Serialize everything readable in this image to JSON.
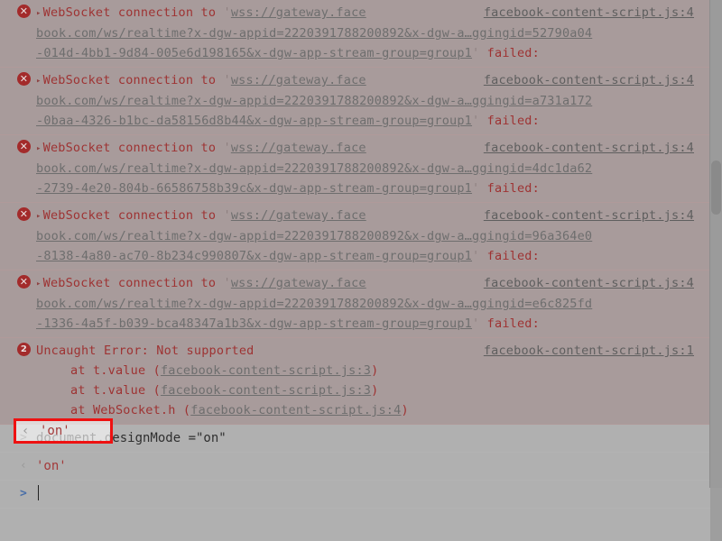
{
  "console": {
    "messages": [
      {
        "kind": "error",
        "icon": "error-circle-icon",
        "disclosure": "▸",
        "prefix": "WebSocket connection to ",
        "open_quote": "'",
        "url_part1": "wss://gateway.face",
        "url_part2": "book.com/ws/realtime?x-dgw-appid=2220391788200892&x-dgw-a…ggingid=52790a04",
        "url_part3": "-014d-4bb1-9d84-005e6d198165&x-dgw-app-stream-group=group1",
        "close_quote": "'",
        "suffix": "failed:",
        "source": "facebook-content-script.js:4"
      },
      {
        "kind": "error",
        "icon": "error-circle-icon",
        "disclosure": "▸",
        "prefix": "WebSocket connection to ",
        "open_quote": "'",
        "url_part1": "wss://gateway.face",
        "url_part2": "book.com/ws/realtime?x-dgw-appid=2220391788200892&x-dgw-a…ggingid=a731a172",
        "url_part3": "-0baa-4326-b1bc-da58156d8b44&x-dgw-app-stream-group=group1",
        "close_quote": "'",
        "suffix": "failed:",
        "source": "facebook-content-script.js:4"
      },
      {
        "kind": "error",
        "icon": "error-circle-icon",
        "disclosure": "▸",
        "prefix": "WebSocket connection to ",
        "open_quote": "'",
        "url_part1": "wss://gateway.face",
        "url_part2": "book.com/ws/realtime?x-dgw-appid=2220391788200892&x-dgw-a…ggingid=4dc1da62",
        "url_part3": "-2739-4e20-804b-66586758b39c&x-dgw-app-stream-group=group1",
        "close_quote": "'",
        "suffix": "failed:",
        "source": "facebook-content-script.js:4"
      },
      {
        "kind": "error",
        "icon": "error-circle-icon",
        "disclosure": "▸",
        "prefix": "WebSocket connection to ",
        "open_quote": "'",
        "url_part1": "wss://gateway.face",
        "url_part2": "book.com/ws/realtime?x-dgw-appid=2220391788200892&x-dgw-a…ggingid=96a364e0",
        "url_part3": "-8138-4a80-ac70-8b234c990807&x-dgw-app-stream-group=group1",
        "close_quote": "'",
        "suffix": "failed:",
        "source": "facebook-content-script.js:4"
      },
      {
        "kind": "error",
        "icon": "error-circle-icon",
        "disclosure": "▸",
        "prefix": "WebSocket connection to ",
        "open_quote": "'",
        "url_part1": "wss://gateway.face",
        "url_part2": "book.com/ws/realtime?x-dgw-appid=2220391788200892&x-dgw-a…ggingid=e6c825fd",
        "url_part3": "-1336-4a5f-b039-bca48347a1b3&x-dgw-app-stream-group=group1",
        "close_quote": "'",
        "suffix": "failed:",
        "source": "facebook-content-script.js:4"
      }
    ],
    "uncaught": {
      "badge_count": "2",
      "title": "Uncaught Error: Not supported",
      "source": "facebook-content-script.js:1",
      "stack": [
        {
          "text": "at t.value (",
          "link": "facebook-content-script.js:3",
          "close": ")"
        },
        {
          "text": "at t.value (",
          "link": "facebook-content-script.js:3",
          "close": ")"
        },
        {
          "text": "at WebSocket.h (",
          "link": "facebook-content-script.js:4",
          "close": ")"
        }
      ]
    },
    "input": {
      "prompt": ">",
      "command": "document.designMode =\"on\""
    },
    "output": {
      "prompt": "‹",
      "value": "'on'"
    },
    "new_prompt": {
      "prompt": ">",
      "placeholder": ""
    }
  },
  "colors": {
    "error_text": "#9e3333",
    "annotation": "#ee1111",
    "link": "#6e6e6e",
    "background": "#a3a3a3"
  }
}
